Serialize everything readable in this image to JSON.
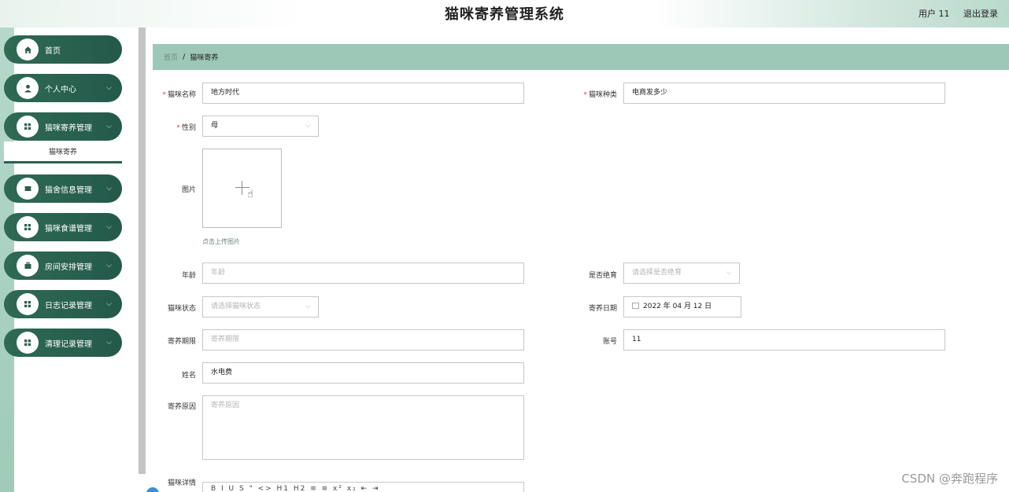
{
  "header": {
    "title": "猫咪寄养管理系统",
    "user_label": "用户 11",
    "logout_label": "退出登录"
  },
  "sidebar": {
    "items": [
      {
        "label": "首页",
        "icon": "home-icon"
      },
      {
        "label": "个人中心",
        "icon": "person-icon"
      },
      {
        "label": "猫咪寄养管理",
        "icon": "grid-icon"
      },
      {
        "label": "猫舍信息管理",
        "icon": "ticket-icon"
      },
      {
        "label": "猫咪食谱管理",
        "icon": "grid-icon"
      },
      {
        "label": "房间安排管理",
        "icon": "briefcase-icon"
      },
      {
        "label": "日志记录管理",
        "icon": "grid-icon"
      },
      {
        "label": "清理记录管理",
        "icon": "grid-icon"
      }
    ],
    "submenu_active": "猫咪寄养"
  },
  "breadcrumb": {
    "home": "首页",
    "separator": "/",
    "current": "猫咪寄养"
  },
  "form": {
    "cat_name": {
      "label": "猫咪名称",
      "value": "地方时代"
    },
    "cat_type": {
      "label": "猫咪种类",
      "value": "电商发多少"
    },
    "gender": {
      "label": "性别",
      "value": "母"
    },
    "image": {
      "label": "图片",
      "hint": "点击上传图片"
    },
    "age": {
      "label": "年龄",
      "placeholder": "年龄"
    },
    "sterilized": {
      "label": "是否绝育",
      "placeholder": "请选择是否绝育"
    },
    "cat_status": {
      "label": "猫咪状态",
      "placeholder": "请选择猫咪状态"
    },
    "boarding_date": {
      "label": "寄养日期",
      "value": "2022 年 04 月 12 日"
    },
    "boarding_period": {
      "label": "寄养期限",
      "placeholder": "寄养期限"
    },
    "account": {
      "label": "账号",
      "value": "11"
    },
    "name": {
      "label": "姓名",
      "value": "水电费"
    },
    "boarding_reason": {
      "label": "寄养原因",
      "placeholder": "寄养原因"
    },
    "cat_detail": {
      "label": "猫咪详情",
      "toolbar": "B I U S \" <> H1 H2 ≡ ≡ x² x₂ ⇤ ⇥"
    }
  },
  "watermark": "CSDN @奔跑程序",
  "colors": {
    "sidebar_item": "#2a6351",
    "breadcrumb_bg": "#9dc8b8",
    "required_mark": "#e0463c"
  }
}
